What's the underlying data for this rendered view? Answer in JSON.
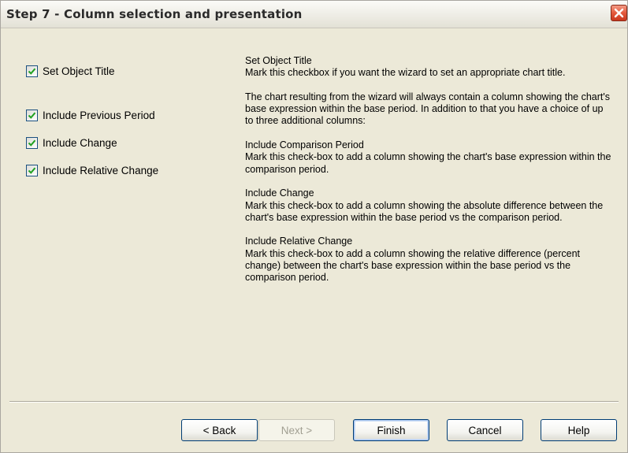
{
  "window": {
    "title": "Step 7 - Column selection and presentation"
  },
  "options": [
    {
      "label": "Set Object Title",
      "checked": true
    },
    {
      "label": "Include Previous Period",
      "checked": true
    },
    {
      "label": "Include Change",
      "checked": true
    },
    {
      "label": "Include Relative Change",
      "checked": true
    }
  ],
  "help": {
    "set_title_heading": "Set Object Title",
    "set_title_body": "Mark this checkbox if you want the wizard to set an appropriate chart title.",
    "intro": "The chart resulting from the wizard will always contain a column showing the chart's base expression within the base period. In addition to that you have a choice of up to three additional columns:",
    "comparison_heading": "Include Comparison Period",
    "comparison_body": "Mark this check-box to add a column showing the chart's base expression within the comparison period.",
    "change_heading": "Include Change",
    "change_body": "Mark this check-box to add a column showing the absolute difference between the chart's base expression within the base period vs the comparison period.",
    "relchange_heading": "Include Relative Change",
    "relchange_body": "Mark this check-box to add a column showing the relative difference (percent change) between the chart's base expression within the base period vs the comparison period."
  },
  "buttons": {
    "back": "< Back",
    "next": "Next >",
    "finish": "Finish",
    "cancel": "Cancel",
    "help": "Help"
  },
  "colors": {
    "window_bg": "#ece9d8",
    "close_button": "#e4593c",
    "checkmark": "#21a121",
    "button_border": "#003c74"
  },
  "icons": {
    "close": "close-icon",
    "check": "checkmark-icon"
  }
}
